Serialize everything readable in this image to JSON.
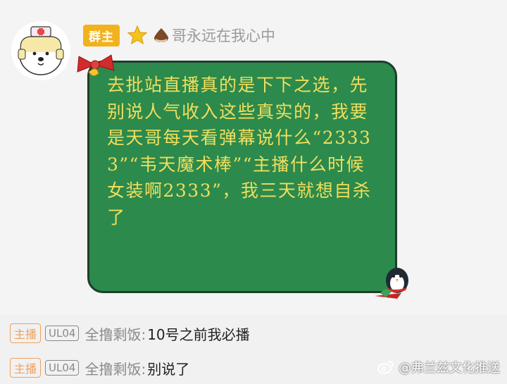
{
  "message": {
    "badge": "群主",
    "username": "哥永远在我心中",
    "text": "去批站直播真的是下下之选，先别说人气收入这些真实的，我要是天哥每天看弹幕说什么“23333”“韦天魔术棒”“主播什么时候女装啊2333”，我三天就想自杀了"
  },
  "danmaku": [
    {
      "tag": "主播",
      "level": "UL04",
      "sender": "全撸剩饭:",
      "text": "10号之前我必播"
    },
    {
      "tag": "主播",
      "level": "UL04",
      "sender": "全撸剩饭:",
      "text": "别说了"
    }
  ],
  "watermark": "@弗兰兹文化推送",
  "icons": {
    "avatar": "polar-bear-nurse-avatar",
    "badge_star": "star-icon",
    "name_icon": "chestnut-icon",
    "decor_top": "christmas-bow-icon",
    "decor_bottom": "penguin-icon",
    "watermark": "weibo-icon"
  },
  "colors": {
    "bubble": "#2c8a4c",
    "bubble_text": "#f1de5d",
    "badge": "#f2b21c",
    "host_tag": "#f0a05a"
  }
}
